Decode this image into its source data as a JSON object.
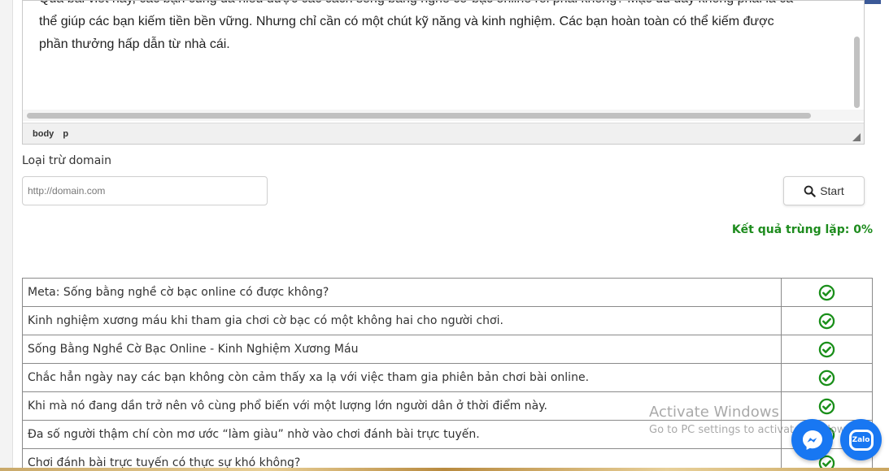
{
  "editor": {
    "lines": [
      "Qua bài viết này, các bạn cũng đã hiểu được các cách sống bằng nghề cờ bạc online rồi phải không? Mặc dù đây không phải là cá",
      "thể giúp các bạn kiếm tiền bền vững. Nhưng chỉ cần có một chút kỹ năng và kinh nghiệm. Các bạn hoàn toàn có thể kiếm được",
      "phần thưởng hấp dẫn từ nhà cái."
    ],
    "path": [
      "body",
      "p"
    ]
  },
  "exclude": {
    "label": "Loại trừ domain",
    "placeholder": "http://domain.com"
  },
  "start_button": {
    "label": "Start",
    "icon": "search-icon"
  },
  "result": {
    "label": "Kết quả trùng lặp:",
    "value": "0%"
  },
  "rows": [
    "Meta: Sống bằng nghề cờ bạc online có được không?",
    "Kinh nghiệm xương máu khi tham gia chơi cờ bạc có một không hai cho người chơi.",
    "Sống Bằng Nghề Cờ Bạc Online - Kinh Nghiệm Xương Máu",
    "Chắc hẳn ngày nay các bạn không còn cảm thấy xa lạ với việc tham gia phiên bản chơi bài online.",
    "Khi mà nó đang dần trở nên vô cùng phổ biến với một lượng lớn người dân ở thời điểm này.",
    "Đa số  người thậm chí còn mơ ước “làm giàu” nhờ vào chơi đánh bài trực tuyến.",
    "Chơi đánh bài trực tuyến có thực sự khó không?"
  ],
  "watermark": {
    "title": "Activate Windows",
    "subtitle": "Go to PC settings to activate Windows."
  },
  "chat": {
    "zalo_label": "Zalo"
  },
  "colors": {
    "success": "#1e8c1e",
    "check": "#1a8f1a",
    "chat_blue": "#1877f2"
  }
}
